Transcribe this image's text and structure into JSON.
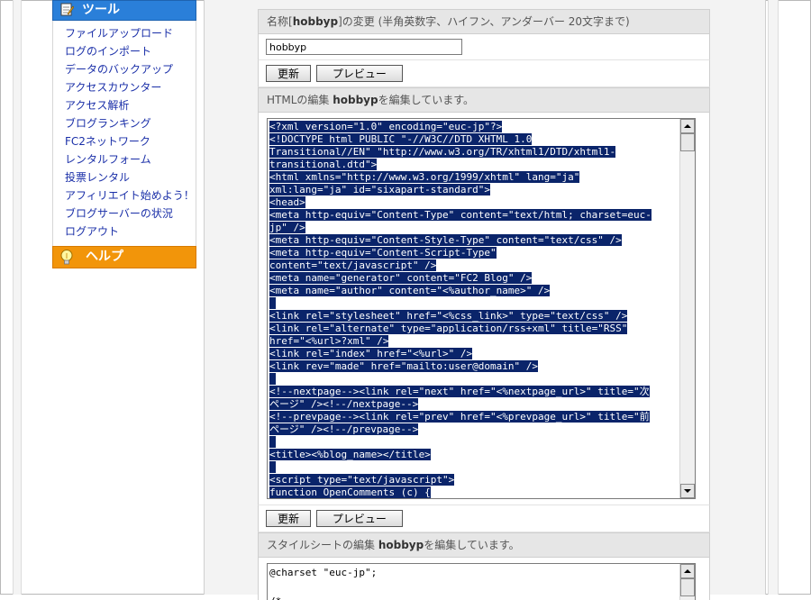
{
  "sidebar": {
    "tools_title": "ツール",
    "items": [
      {
        "label": "ファイルアップロード"
      },
      {
        "label": "ログのインポート"
      },
      {
        "label": "データのバックアップ"
      },
      {
        "label": "アクセスカウンター"
      },
      {
        "label": "アクセス解析"
      },
      {
        "label": "ブログランキング"
      },
      {
        "label": "FC2ネットワーク"
      },
      {
        "label": "レンタルフォーム"
      },
      {
        "label": "投票レンタル"
      },
      {
        "label": "アフィリエイト始めよう！"
      },
      {
        "label": "ブログサーバーの状況"
      },
      {
        "label": "ログアウト"
      }
    ],
    "help_title": "ヘルプ"
  },
  "name_section": {
    "title_prefix": "名称[",
    "title_bold": "hobbyp",
    "title_suffix": "]の変更 (半角英数字、ハイフン、アンダーバー 20文字まで)",
    "input_value": "hobbyp"
  },
  "buttons": {
    "update": "更新",
    "preview": "プレビュー"
  },
  "html_section": {
    "title_prefix": "HTMLの編集 ",
    "title_bold": "hobbyp",
    "title_suffix": "を編集しています。",
    "code_lines": [
      "<?xml version=\"1.0\" encoding=\"euc-jp\"?>",
      "<!DOCTYPE html PUBLIC \"-//W3C//DTD XHTML 1.0",
      "Transitional//EN\" \"http://www.w3.org/TR/xhtml1/DTD/xhtml1-",
      "transitional.dtd\">",
      "<html xmlns=\"http://www.w3.org/1999/xhtml\" lang=\"ja\"",
      "xml:lang=\"ja\" id=\"sixapart-standard\">",
      "<head>",
      "<meta http-equiv=\"Content-Type\" content=\"text/html; charset=euc-",
      "jp\" />",
      "<meta http-equiv=\"Content-Style-Type\" content=\"text/css\" />",
      "<meta http-equiv=\"Content-Script-Type\"",
      "content=\"text/javascript\" />",
      "<meta name=\"generator\" content=\"FC2 Blog\" />",
      "<meta name=\"author\" content=\"<%author_name>\" />",
      "",
      "<link rel=\"stylesheet\" href=\"<%css_link>\" type=\"text/css\" />",
      "<link rel=\"alternate\" type=\"application/rss+xml\" title=\"RSS\"",
      "href=\"<%url>?xml\" />",
      "<link rel=\"index\" href=\"<%url>\" />",
      "<link rev=\"made\" href=\"mailto:user@domain\" />",
      "",
      "<!--nextpage--><link rel=\"next\" href=\"<%nextpage_url>\" title=\"次",
      "ページ\" /><!--/nextpage-->",
      "<!--prevpage--><link rel=\"prev\" href=\"<%prevpage_url>\" title=\"前",
      "ページ\" /><!--/prevpage-->",
      "",
      "<title><%blog_name></title>",
      "",
      "<script type=\"text/javascript\">",
      "function OpenComments (c) {"
    ]
  },
  "css_section": {
    "title_prefix": "スタイルシートの編集 ",
    "title_bold": "hobbyp",
    "title_suffix": "を編集しています。",
    "code_lines": [
      "@charset \"euc-jp\";",
      "",
      "/*"
    ]
  },
  "colors": {
    "tools_header": "#2a7fd9",
    "help_header": "#f2950a",
    "selection": "#0a246a",
    "link": "#1a2fa8"
  }
}
